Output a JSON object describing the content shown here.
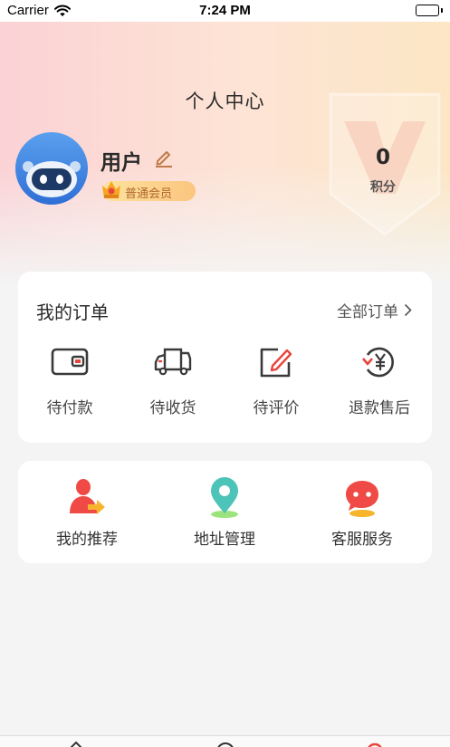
{
  "status_bar": {
    "carrier": "Carrier",
    "time": "7:24 PM"
  },
  "header": {
    "title": "个人中心"
  },
  "profile": {
    "username": "用户",
    "member_level": "普通会员",
    "points_value": "0",
    "points_label": "积分"
  },
  "orders": {
    "title": "我的订单",
    "all_label": "全部订单",
    "items": [
      {
        "label": "待付款",
        "icon": "wallet-icon"
      },
      {
        "label": "待收货",
        "icon": "truck-icon"
      },
      {
        "label": "待评价",
        "icon": "review-edit-icon"
      },
      {
        "label": "退款售后",
        "icon": "refund-yen-icon"
      }
    ]
  },
  "services": {
    "items": [
      {
        "label": "我的推荐",
        "icon": "referral-user-icon"
      },
      {
        "label": "地址管理",
        "icon": "location-pin-icon"
      },
      {
        "label": "客服服务",
        "icon": "chat-bubble-icon"
      }
    ]
  },
  "tab_bar": {
    "icons": [
      "home-icon",
      "category-icon",
      "profile-icon"
    ]
  },
  "colors": {
    "accent_red": "#e8453c",
    "member_text": "#b0662d",
    "pin_teal": "#4cc4b8"
  }
}
